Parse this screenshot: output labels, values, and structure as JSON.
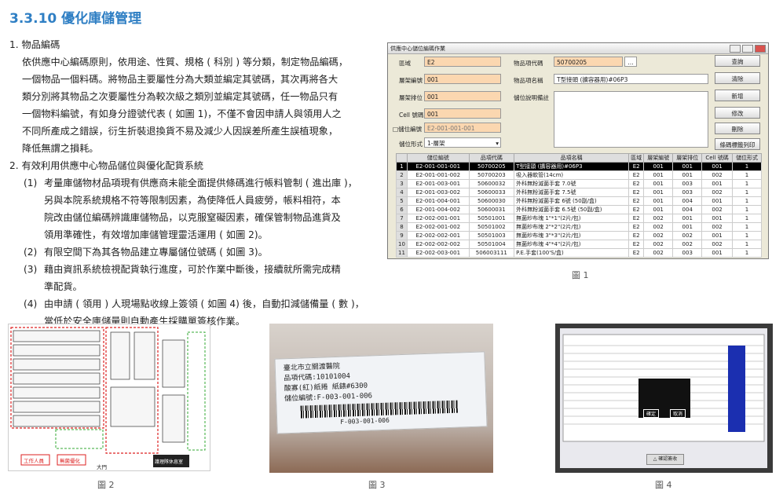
{
  "heading": "3.3.10 優化庫儲管理",
  "section1": {
    "title": "1. 物品編碼",
    "lines": [
      "依供應中心編碼原則，依用途、性質、規格 ( 科別 ) 等分類，制定物品編碼，",
      "一個物品一個料碼。將物品主要屬性分為大類並編定其號碼，其次再將各大",
      "類分別將其物品之次要屬性分為較次級之類別並編定其號碼，任一物品只有",
      "一個物料編號，有如身分證號代表 ( 如圖 1)，不僅不會因申請人與領用人之",
      "不同所產成之錯誤，衍生折裝退換貨不易及減少人因誤差所產生誤植現象，",
      "降低無謂之損耗。"
    ]
  },
  "section2": {
    "title": "2. 有效利用供應中心物品儲位與優化配貨系統",
    "items": [
      {
        "num": "(1)",
        "lines": [
          "考量庫儲物材品項現有供應商未能全面提供條碼進行帳料管制 ( 進出庫 )，",
          "另與本院系統規格不符等限制因素，為使降低人員疲勞，帳料相符，本",
          "院改由儲位編碼辨識庫儲物品，以克服窒礙因素，確保管制物品進貨及",
          "領用準確性，有效增加庫儲管理靈活運用 ( 如圖 2)。"
        ]
      },
      {
        "num": "(2)",
        "lines": [
          "有限空間下為其各物品建立專屬儲位號碼 ( 如圖 3)。"
        ]
      },
      {
        "num": "(3)",
        "lines": [
          "藉由資訊系統檢視配貨執行進度，可於作業中斷後，接續就所需完成精",
          "準配貨。"
        ]
      },
      {
        "num": "(4)",
        "lines": [
          "由申請 ( 領用 ) 人現場點收線上簽領 ( 如圖 4) 後，自動扣減儲備量 ( 數 )，",
          "當低於安全庫儲量則自動產生採購單簽核作業。"
        ]
      }
    ]
  },
  "figure1": {
    "window_title": "供應中心儲位編碼作業",
    "labels": {
      "area": "區域",
      "shelf_no": "層架編號",
      "shelf_pos": "層架排位",
      "cell": "Cell 號碼",
      "storage_code": "□儲位編號",
      "storage_form": "儲位形式",
      "item_code": "物品項代碼",
      "item_name": "物品項名稱",
      "desc": "儲位說明備註"
    },
    "values": {
      "area": "E2",
      "shelf_no": "001",
      "shelf_pos": "001",
      "cell": "001",
      "storage_code": "E2-001-001-001",
      "storage_form": "1-層架",
      "item_code": "50700205",
      "item_name": "T型接頭 (擴容器用)#06P3"
    },
    "buttons": [
      "查詢",
      "清除",
      "新增",
      "修改",
      "刪除",
      "條碼標籤列印"
    ],
    "columns": [
      "",
      "儲位編號",
      "品項代碼",
      "品項名稱",
      "區域",
      "層架編號",
      "層架排位",
      "Cell 號碼",
      "儲位形式"
    ],
    "rows": [
      [
        "1",
        "E2-001-001-001",
        "50700205",
        "T型接頭 (擴容器用)#06P3",
        "E2",
        "001",
        "001",
        "001",
        "1"
      ],
      [
        "2",
        "E2-001-001-002",
        "50700203",
        "吸入器軟管(14cm)",
        "E2",
        "001",
        "001",
        "002",
        "1"
      ],
      [
        "3",
        "E2-001-003-001",
        "50600032",
        "外科無粉滅菌手套 7.0號",
        "E2",
        "001",
        "003",
        "001",
        "1"
      ],
      [
        "4",
        "E2-001-003-002",
        "50600033",
        "外科無粉滅菌手套 7.5號",
        "E2",
        "001",
        "003",
        "002",
        "1"
      ],
      [
        "5",
        "E2-001-004-001",
        "50600030",
        "外科無粉滅菌手套 6號 (50副/盒)",
        "E2",
        "001",
        "004",
        "001",
        "1"
      ],
      [
        "6",
        "E2-001-004-002",
        "50600031",
        "外科無粉滅菌手套 6.5號 (50副/盒)",
        "E2",
        "001",
        "004",
        "002",
        "1"
      ],
      [
        "7",
        "E2-002-001-001",
        "50501001",
        "無菌紗布塊 1\"*1\"(2片/包)",
        "E2",
        "002",
        "001",
        "001",
        "1"
      ],
      [
        "8",
        "E2-002-001-002",
        "50501002",
        "無菌紗布塊 2\"*2\"(2片/包)",
        "E2",
        "002",
        "001",
        "002",
        "1"
      ],
      [
        "9",
        "E2-002-002-001",
        "50501003",
        "無菌紗布塊 3\"*3\"(2片/包)",
        "E2",
        "002",
        "002",
        "001",
        "1"
      ],
      [
        "10",
        "E2-002-002-002",
        "50501004",
        "無菌紗布塊 4\"*4\"(2片/包)",
        "E2",
        "002",
        "002",
        "002",
        "1"
      ],
      [
        "11",
        "E2-002-003-001",
        "506003111",
        "P.E.手套(100'S/盒)",
        "E2",
        "002",
        "003",
        "001",
        "1"
      ]
    ],
    "caption": "圖 1"
  },
  "figure2": {
    "caption": "圖 2",
    "legend": [
      "工作人員",
      "無菌優化"
    ],
    "bottom_label": "大門",
    "footer": "護理隊休息室"
  },
  "figure3": {
    "caption": "圖 3",
    "label_lines": [
      "臺北市立關渡醫院",
      "品項代碼:10101004",
      "酸寡(紅)紙捲 紙錶#6300",
      "儲位編號:F-003-001-006"
    ],
    "barcode_text": "F-003-001-006"
  },
  "figure4": {
    "caption": "圖 4",
    "confirm_button": "△ 確認簽收",
    "dialog_buttons": [
      "確定",
      "取消"
    ]
  },
  "colors": {
    "heading": "#2f7fc4",
    "field_fill": "#fbd7b0"
  }
}
